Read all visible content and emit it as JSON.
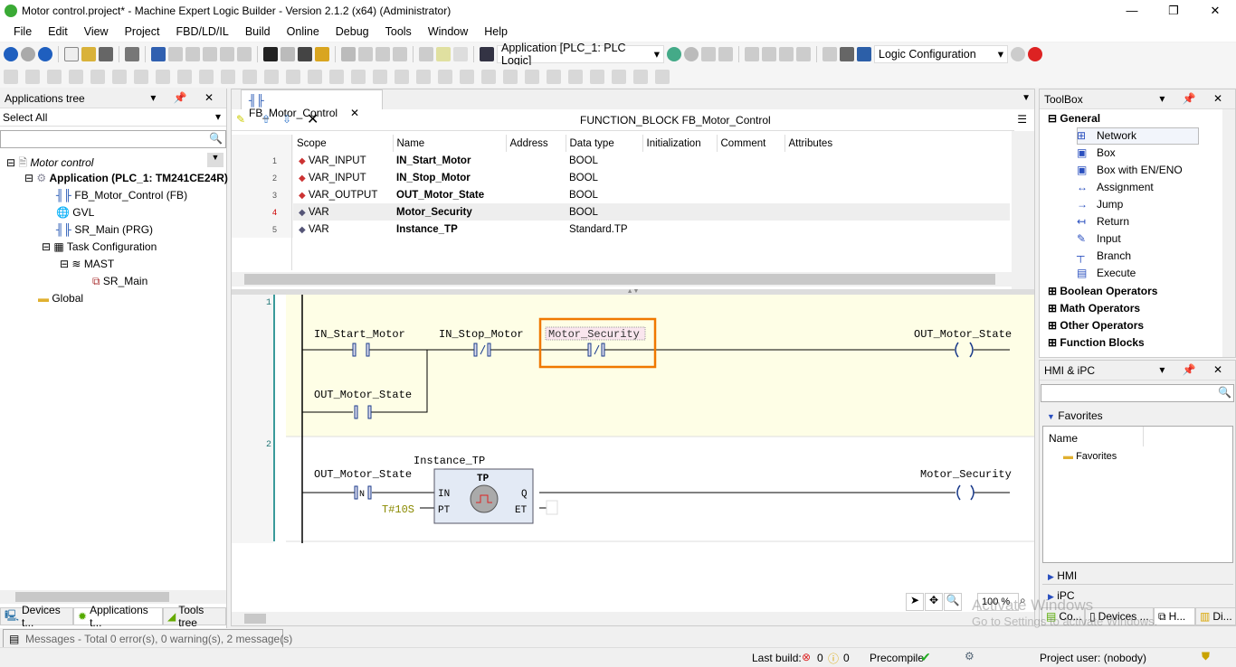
{
  "window": {
    "title": "Motor control.project* - Machine Expert Logic Builder - Version 2.1.2 (x64) (Administrator)",
    "minimize": "—",
    "maximize": "❐",
    "close": "✕"
  },
  "menu": [
    "File",
    "Edit",
    "View",
    "Project",
    "FBD/LD/IL",
    "Build",
    "Online",
    "Debug",
    "Tools",
    "Window",
    "Help"
  ],
  "toolbar": {
    "application_combo": "Application [PLC_1: PLC Logic]",
    "config_combo": "Logic Configuration"
  },
  "left_panel": {
    "title": "Applications tree",
    "filter": "Select All",
    "search_placeholder": "",
    "tree": [
      {
        "label": "Motor control",
        "level": 0
      },
      {
        "label": "Application (PLC_1: TM241CE24R)",
        "level": 1
      },
      {
        "label": "FB_Motor_Control (FB)",
        "level": 2
      },
      {
        "label": "GVL",
        "level": 2
      },
      {
        "label": "SR_Main (PRG)",
        "level": 2
      },
      {
        "label": "Task Configuration",
        "level": 2
      },
      {
        "label": "MAST",
        "level": 3
      },
      {
        "label": "SR_Main",
        "level": 4
      },
      {
        "label": "Global",
        "level": 1
      }
    ],
    "tabs": [
      "Devices t...",
      "Applications t...",
      "Tools tree"
    ]
  },
  "editor": {
    "tab": "FB_Motor_Control",
    "header": "FUNCTION_BLOCK FB_Motor_Control",
    "columns": [
      "Scope",
      "Name",
      "Address",
      "Data type",
      "Initialization",
      "Comment",
      "Attributes"
    ],
    "rows": [
      {
        "n": "1",
        "scope": "VAR_INPUT",
        "name": "IN_Start_Motor",
        "type": "BOOL"
      },
      {
        "n": "2",
        "scope": "VAR_INPUT",
        "name": "IN_Stop_Motor",
        "type": "BOOL"
      },
      {
        "n": "3",
        "scope": "VAR_OUTPUT",
        "name": "OUT_Motor_State",
        "type": "BOOL"
      },
      {
        "n": "4",
        "scope": "VAR",
        "name": "Motor_Security",
        "type": "BOOL"
      },
      {
        "n": "5",
        "scope": "VAR",
        "name": "Instance_TP",
        "type": "Standard.TP"
      }
    ],
    "ld": {
      "net1": {
        "num": "1",
        "c1": "IN_Start_Motor",
        "c2": "IN_Stop_Motor",
        "c3": "Motor_Security",
        "coil": "OUT_Motor_State",
        "par": "OUT_Motor_State"
      },
      "net2": {
        "num": "2",
        "c1": "OUT_Motor_State",
        "c1_mark": "N",
        "inst": "Instance_TP",
        "fb": "TP",
        "in": "IN",
        "pt": "PT",
        "q": "Q",
        "et": "ET",
        "ptval": "T#10S",
        "coil": "Motor_Security"
      },
      "highlight_color": "#f07800"
    },
    "zoom": "100 %"
  },
  "toolbox": {
    "title": "ToolBox",
    "general": "General",
    "items": [
      "Network",
      "Box",
      "Box with EN/ENO",
      "Assignment",
      "Jump",
      "Return",
      "Input",
      "Branch",
      "Execute"
    ],
    "groups": [
      "Boolean Operators",
      "Math Operators",
      "Other Operators",
      "Function Blocks"
    ]
  },
  "hmi": {
    "title": "HMI & iPC",
    "favorites": "Favorites",
    "col": "Name",
    "fav_item": "Favorites",
    "hmi": "HMI",
    "ipc": "iPC",
    "tabs": [
      "Co...",
      "Devices ...",
      "H...",
      "Di..."
    ]
  },
  "messages": "Messages - Total 0 error(s), 0 warning(s), 2 message(s)",
  "status": {
    "last_build": "Last build:",
    "errors": "0",
    "warnings": "0",
    "precompile": "Precompile",
    "user": "Project user: (nobody)"
  },
  "watermark": {
    "l1": "Activate Windows",
    "l2": "Go to Settings to activate Windows."
  }
}
